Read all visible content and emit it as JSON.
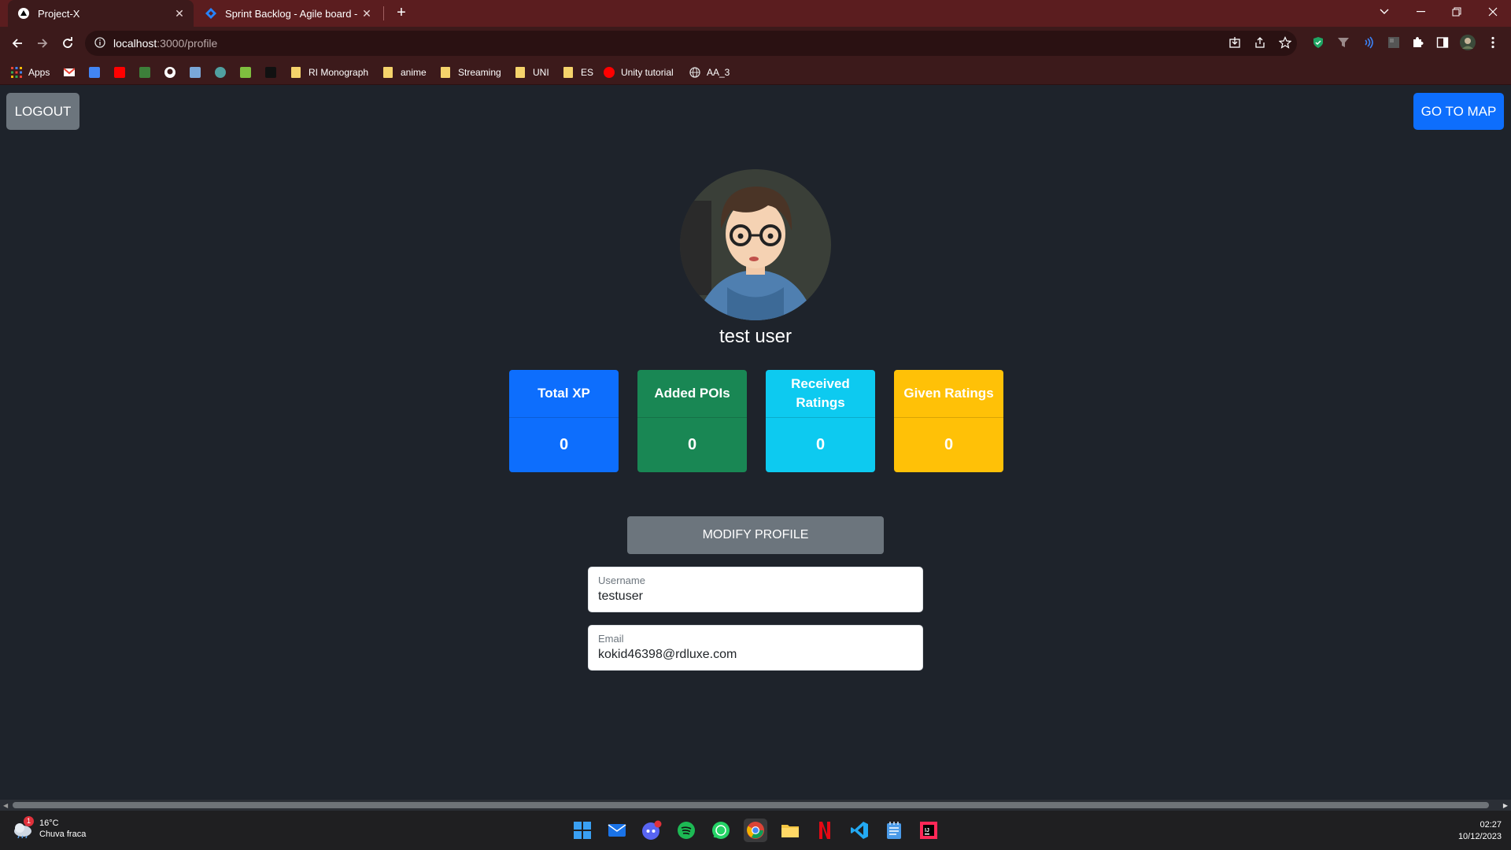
{
  "browser": {
    "tabs": [
      {
        "title": "Project-X",
        "favicon": "project-x-logo-icon"
      },
      {
        "title": "Sprint Backlog - Agile board - Ji",
        "favicon": "jira-logo-icon"
      }
    ],
    "url": {
      "host": "localhost",
      "path": ":3000/profile"
    },
    "bookmarks": [
      {
        "label": "Apps"
      },
      {
        "label": "RI Monograph"
      },
      {
        "label": "anime"
      },
      {
        "label": "Streaming"
      },
      {
        "label": "UNI"
      },
      {
        "label": "ES"
      },
      {
        "label": "Unity tutorial"
      },
      {
        "label": "AA_3"
      }
    ]
  },
  "header": {
    "logout_label": "LOGOUT",
    "go_to_map_label": "GO TO MAP"
  },
  "profile": {
    "display_name": "test user",
    "stats": [
      {
        "label": "Total XP",
        "value": "0",
        "color": "#0d6efd"
      },
      {
        "label": "Added POIs",
        "value": "0",
        "color": "#198754"
      },
      {
        "label": "Received Ratings",
        "value": "0",
        "color": "#0dcaf0"
      },
      {
        "label": "Given Ratings",
        "value": "0",
        "color": "#ffc107"
      }
    ],
    "modify_label": "MODIFY PROFILE",
    "fields": {
      "username": {
        "label": "Username",
        "value": "testuser"
      },
      "email": {
        "label": "Email",
        "value": "kokid46398@rdluxe.com"
      }
    }
  },
  "taskbar": {
    "weather": {
      "temp": "16°C",
      "desc": "Chuva fraca",
      "badge": "1"
    },
    "time": "02:27",
    "date": "10/12/2023"
  }
}
